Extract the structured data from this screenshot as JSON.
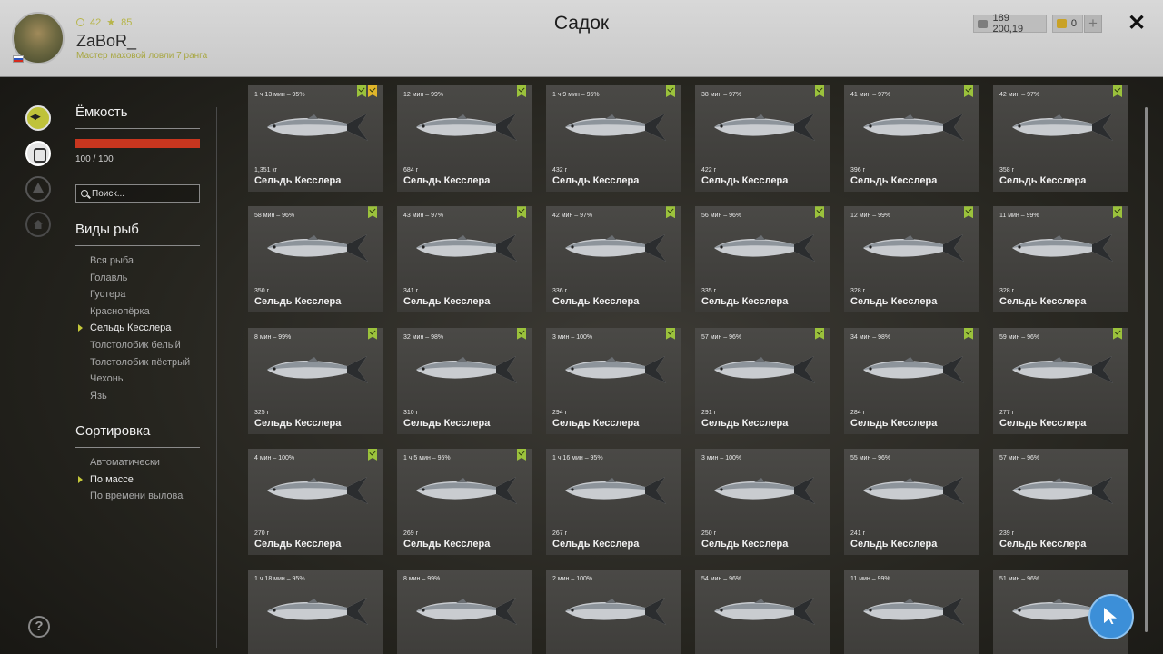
{
  "header": {
    "title": "Садок",
    "player": {
      "name": "ZaBoR_",
      "level": "42",
      "stars": "85",
      "rank": "Мастер маховой ловли 7 ранга"
    },
    "silver": "189 200,19",
    "gold": "0",
    "plus_label": "+",
    "close_label": "✕"
  },
  "sidebar": {
    "capacity_title": "Ёмкость",
    "capacity_value": "100 / 100",
    "capacity_fill": 1.0,
    "search_placeholder": "Поиск...",
    "species_title": "Виды рыб",
    "species": [
      "Вся рыба",
      "Голавль",
      "Густера",
      "Краснопёрка",
      "Сельдь Кесслера",
      "Толстолобик белый",
      "Толстолобик пёстрый",
      "Чехонь",
      "Язь"
    ],
    "species_active": 4,
    "sort_title": "Сортировка",
    "sort": [
      "Автоматически",
      "По массе",
      "По времени вылова"
    ],
    "sort_active": 1
  },
  "help_label": "?",
  "fish": [
    {
      "time": "1 ч 13 мин – 95%",
      "weight": "1,351 кг",
      "name": "Сельдь Кесслера",
      "badges": [
        "green",
        "yellow"
      ]
    },
    {
      "time": "12 мин – 99%",
      "weight": "684 г",
      "name": "Сельдь Кесслера",
      "badges": [
        "green"
      ]
    },
    {
      "time": "1 ч 9 мин – 95%",
      "weight": "432 г",
      "name": "Сельдь Кесслера",
      "badges": [
        "green"
      ]
    },
    {
      "time": "38 мин – 97%",
      "weight": "422 г",
      "name": "Сельдь Кесслера",
      "badges": [
        "green"
      ]
    },
    {
      "time": "41 мин – 97%",
      "weight": "396 г",
      "name": "Сельдь Кесслера",
      "badges": [
        "green"
      ]
    },
    {
      "time": "42 мин – 97%",
      "weight": "358 г",
      "name": "Сельдь Кесслера",
      "badges": [
        "green"
      ]
    },
    {
      "time": "58 мин – 96%",
      "weight": "350 г",
      "name": "Сельдь Кесслера",
      "badges": [
        "green"
      ]
    },
    {
      "time": "43 мин – 97%",
      "weight": "341 г",
      "name": "Сельдь Кесслера",
      "badges": [
        "green"
      ]
    },
    {
      "time": "42 мин – 97%",
      "weight": "336 г",
      "name": "Сельдь Кесслера",
      "badges": [
        "green"
      ]
    },
    {
      "time": "56 мин – 96%",
      "weight": "335 г",
      "name": "Сельдь Кесслера",
      "badges": [
        "green"
      ]
    },
    {
      "time": "12 мин – 99%",
      "weight": "328 г",
      "name": "Сельдь Кесслера",
      "badges": [
        "green"
      ]
    },
    {
      "time": "11 мин – 99%",
      "weight": "328 г",
      "name": "Сельдь Кесслера",
      "badges": [
        "green"
      ]
    },
    {
      "time": "8 мин – 99%",
      "weight": "325 г",
      "name": "Сельдь Кесслера",
      "badges": [
        "green"
      ]
    },
    {
      "time": "32 мин – 98%",
      "weight": "310 г",
      "name": "Сельдь Кесслера",
      "badges": [
        "green"
      ]
    },
    {
      "time": "3 мин – 100%",
      "weight": "294 г",
      "name": "Сельдь Кесслера",
      "badges": [
        "green"
      ]
    },
    {
      "time": "57 мин – 96%",
      "weight": "291 г",
      "name": "Сельдь Кесслера",
      "badges": [
        "green"
      ]
    },
    {
      "time": "34 мин – 98%",
      "weight": "284 г",
      "name": "Сельдь Кесслера",
      "badges": [
        "green"
      ]
    },
    {
      "time": "59 мин – 96%",
      "weight": "277 г",
      "name": "Сельдь Кесслера",
      "badges": [
        "green"
      ]
    },
    {
      "time": "4 мин – 100%",
      "weight": "270 г",
      "name": "Сельдь Кесслера",
      "badges": [
        "green"
      ]
    },
    {
      "time": "1 ч 5 мин – 95%",
      "weight": "269 г",
      "name": "Сельдь Кесслера",
      "badges": [
        "green"
      ]
    },
    {
      "time": "1 ч 16 мин – 95%",
      "weight": "267 г",
      "name": "Сельдь Кесслера",
      "badges": []
    },
    {
      "time": "3 мин – 100%",
      "weight": "250 г",
      "name": "Сельдь Кесслера",
      "badges": []
    },
    {
      "time": "55 мин – 96%",
      "weight": "241 г",
      "name": "Сельдь Кесслера",
      "badges": []
    },
    {
      "time": "57 мин – 96%",
      "weight": "239 г",
      "name": "Сельдь Кесслера",
      "badges": []
    },
    {
      "time": "1 ч 18 мин – 95%",
      "weight": "",
      "name": "",
      "badges": []
    },
    {
      "time": "8 мин – 99%",
      "weight": "",
      "name": "",
      "badges": []
    },
    {
      "time": "2 мин – 100%",
      "weight": "",
      "name": "",
      "badges": []
    },
    {
      "time": "54 мин – 96%",
      "weight": "",
      "name": "",
      "badges": []
    },
    {
      "time": "11 мин – 99%",
      "weight": "",
      "name": "",
      "badges": []
    },
    {
      "time": "51 мин – 96%",
      "weight": "",
      "name": "",
      "badges": []
    }
  ]
}
